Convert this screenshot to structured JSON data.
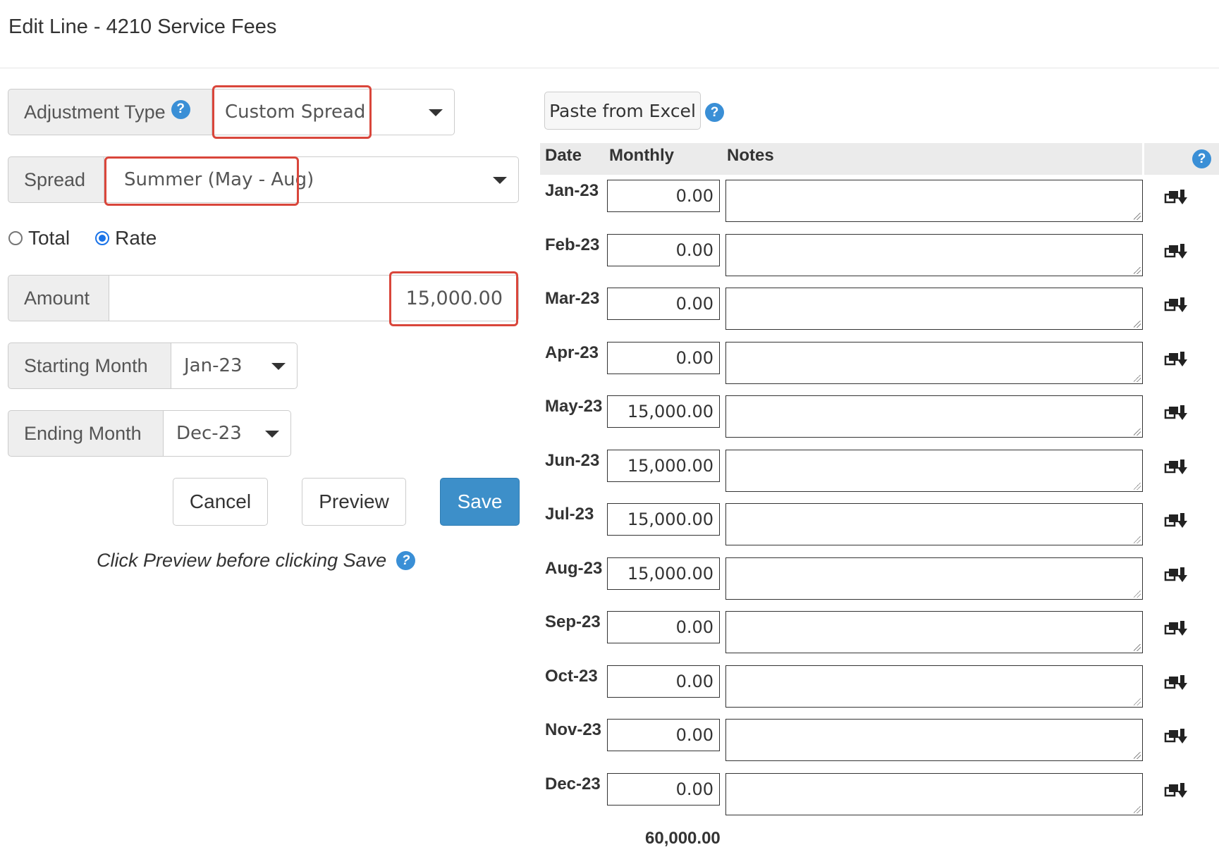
{
  "dialog": {
    "title": "Edit Line - 4210 Service Fees"
  },
  "form": {
    "adjustment_type": {
      "label": "Adjustment Type",
      "value": "Custom Spread",
      "help": "?"
    },
    "spread": {
      "label": "Spread",
      "value": "Summer (May - Aug)"
    },
    "mode": {
      "total_label": "Total",
      "rate_label": "Rate",
      "selected": "Rate"
    },
    "amount": {
      "label": "Amount",
      "value": "15,000.00"
    },
    "starting_month": {
      "label": "Starting Month",
      "value": "Jan-23"
    },
    "ending_month": {
      "label": "Ending Month",
      "value": "Dec-23"
    },
    "buttons": {
      "cancel": "Cancel",
      "preview": "Preview",
      "save": "Save"
    },
    "hint": {
      "text": "Click Preview before clicking Save",
      "help": "?"
    }
  },
  "grid": {
    "paste_label": "Paste from Excel",
    "paste_help": "?",
    "columns": {
      "date": "Date",
      "monthly": "Monthly",
      "notes": "Notes",
      "help": "?"
    },
    "rows": [
      {
        "date": "Jan-23",
        "monthly": "0.00",
        "notes": ""
      },
      {
        "date": "Feb-23",
        "monthly": "0.00",
        "notes": ""
      },
      {
        "date": "Mar-23",
        "monthly": "0.00",
        "notes": ""
      },
      {
        "date": "Apr-23",
        "monthly": "0.00",
        "notes": ""
      },
      {
        "date": "May-23",
        "monthly": "15,000.00",
        "notes": ""
      },
      {
        "date": "Jun-23",
        "monthly": "15,000.00",
        "notes": ""
      },
      {
        "date": "Jul-23",
        "monthly": "15,000.00",
        "notes": ""
      },
      {
        "date": "Aug-23",
        "monthly": "15,000.00",
        "notes": ""
      },
      {
        "date": "Sep-23",
        "monthly": "0.00",
        "notes": ""
      },
      {
        "date": "Oct-23",
        "monthly": "0.00",
        "notes": ""
      },
      {
        "date": "Nov-23",
        "monthly": "0.00",
        "notes": ""
      },
      {
        "date": "Dec-23",
        "monthly": "0.00",
        "notes": ""
      }
    ],
    "total": "60,000.00",
    "row_icon": "copy-down-icon"
  },
  "colors": {
    "primary": "#3d8fc9",
    "highlight": "#d9463b",
    "help": "#3a8fd6"
  }
}
